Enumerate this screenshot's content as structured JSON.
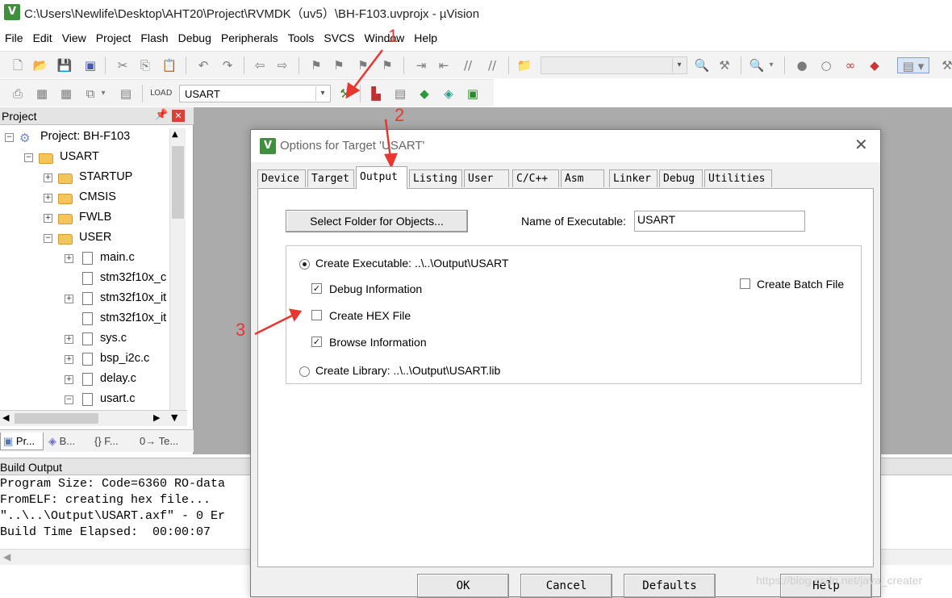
{
  "window": {
    "title": "C:\\Users\\Newlife\\Desktop\\AHT20\\Project\\RVMDK（uv5）\\BH-F103.uvprojx - µVision",
    "app_icon": "V"
  },
  "menubar": [
    "File",
    "Edit",
    "View",
    "Project",
    "Flash",
    "Debug",
    "Peripherals",
    "Tools",
    "SVCS",
    "Window",
    "Help"
  ],
  "toolbar2": {
    "target": "USART"
  },
  "project_panel": {
    "header": "Project",
    "pin_icon": "pin-icon",
    "tree": [
      {
        "label": "Project: BH-F103",
        "level": 0,
        "expander": "−",
        "icon": "project"
      },
      {
        "label": "USART",
        "level": 1,
        "expander": "−",
        "icon": "folder"
      },
      {
        "label": "STARTUP",
        "level": 2,
        "expander": "+",
        "icon": "folder"
      },
      {
        "label": "CMSIS",
        "level": 2,
        "expander": "+",
        "icon": "folder"
      },
      {
        "label": "FWLB",
        "level": 2,
        "expander": "+",
        "icon": "folder"
      },
      {
        "label": "USER",
        "level": 2,
        "expander": "−",
        "icon": "folder"
      },
      {
        "label": "main.c",
        "level": 3,
        "expander": "+",
        "icon": "file"
      },
      {
        "label": "stm32f10x_c",
        "level": 3,
        "expander": "",
        "icon": "file"
      },
      {
        "label": "stm32f10x_it",
        "level": 3,
        "expander": "+",
        "icon": "file"
      },
      {
        "label": "stm32f10x_it",
        "level": 3,
        "expander": "",
        "icon": "file"
      },
      {
        "label": "sys.c",
        "level": 3,
        "expander": "+",
        "icon": "file"
      },
      {
        "label": "bsp_i2c.c",
        "level": 3,
        "expander": "+",
        "icon": "file"
      },
      {
        "label": "delay.c",
        "level": 3,
        "expander": "+",
        "icon": "file"
      },
      {
        "label": "usart.c",
        "level": 3,
        "expander": "−",
        "icon": "file"
      }
    ],
    "tabs": [
      "Pr...",
      "B...",
      "{} F...",
      "0→ Te..."
    ]
  },
  "build_output": {
    "header": "Build Output",
    "lines": [
      "Program Size: Code=6360 RO-data",
      "FromELF: creating hex file...",
      "\"..\\..\\Output\\USART.axf\" - 0 Er",
      "Build Time Elapsed:  00:00:07"
    ]
  },
  "dialog": {
    "title": "Options for Target 'USART'",
    "tabs": [
      "Device",
      "Target",
      "Output",
      "Listing",
      "User",
      "C/C++",
      "Asm",
      "Linker",
      "Debug",
      "Utilities"
    ],
    "active_tab": "Output",
    "select_folder_label": "Select Folder for Objects...",
    "exe_name_label": "Name of Executable:",
    "exe_name_value": "USART",
    "create_executable_label": "Create Executable:  ..\\..\\Output\\USART",
    "debug_info_label": "Debug Information",
    "create_hex_label": "Create HEX File",
    "browse_info_label": "Browse Information",
    "create_library_label": "Create Library:  ..\\..\\Output\\USART.lib",
    "create_batch_label": "Create Batch File",
    "checks": {
      "debug_info": true,
      "create_hex": false,
      "browse_info": true,
      "create_batch": false
    },
    "radio_selected": "create_executable",
    "buttons": {
      "ok": "OK",
      "cancel": "Cancel",
      "defaults": "Defaults",
      "help": "Help"
    }
  },
  "annotations": {
    "a1": "1",
    "a2": "2",
    "a3": "3",
    "color": "#e8372e"
  },
  "watermark": "https://blog.csdn.net/java_creater"
}
